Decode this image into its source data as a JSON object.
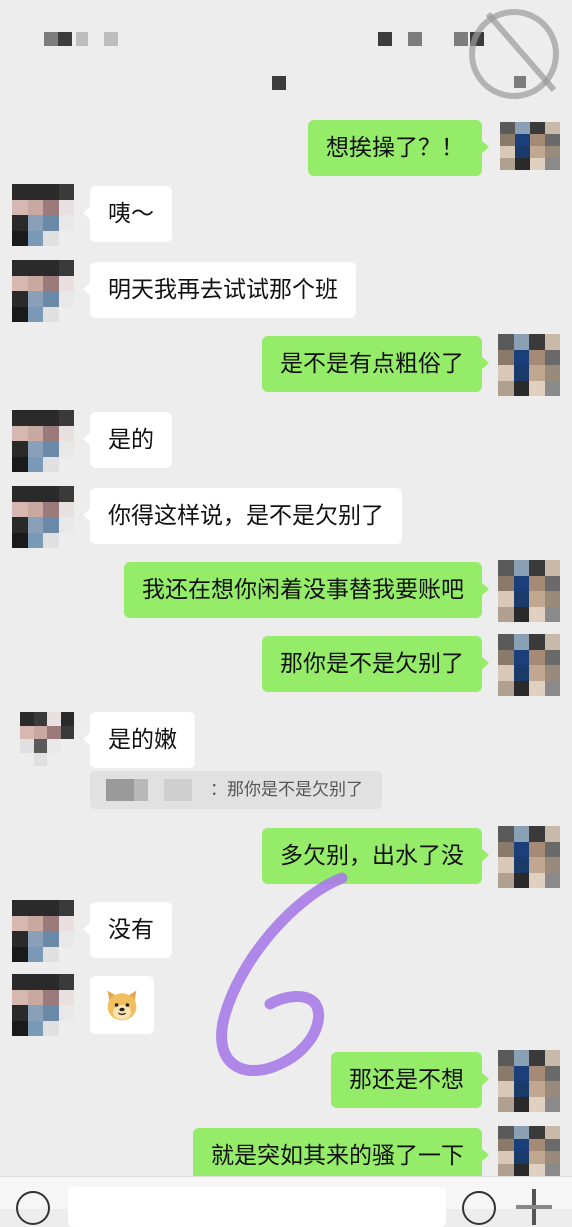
{
  "messages": [
    {
      "side": "right",
      "text": "想挨操了？！"
    },
    {
      "side": "left",
      "text": "咦～"
    },
    {
      "side": "left",
      "text": "明天我再去试试那个班"
    },
    {
      "side": "right",
      "text": "是不是有点粗俗了"
    },
    {
      "side": "left",
      "text": "是的"
    },
    {
      "side": "left",
      "text": "你得这样说，是不是欠别了"
    },
    {
      "side": "right",
      "text": "我还在想你闲着没事替我要账吧"
    },
    {
      "side": "right",
      "text": "那你是不是欠别了"
    },
    {
      "side": "left",
      "text": "是的嫩"
    },
    {
      "side": "right",
      "text": "多欠别，出水了没"
    },
    {
      "side": "left",
      "text": "没有"
    },
    {
      "side": "left",
      "emoji": "doge-emoji"
    },
    {
      "side": "right",
      "text": "那还是不想"
    },
    {
      "side": "right",
      "text": "就是突如其来的骚了一下"
    }
  ],
  "quote": {
    "text": "：那你是不是欠别了"
  },
  "annotation": {
    "text": "6",
    "color": "#a77be8"
  },
  "colors": {
    "background": "#ededed",
    "outgoing_bubble": "#95ec69",
    "incoming_bubble": "#ffffff"
  }
}
